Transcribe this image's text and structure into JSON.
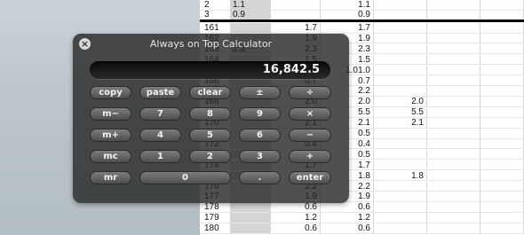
{
  "spreadsheet": {
    "rows": [
      [
        "2",
        "1.1",
        "",
        "1.1",
        "",
        ""
      ],
      [
        "3",
        "0.9",
        "",
        "0.9",
        "",
        ""
      ],
      [
        "161",
        "",
        "1.7",
        "1.7",
        "",
        ""
      ],
      [
        "162",
        "",
        "1.9",
        "1.9",
        "",
        ""
      ],
      [
        "163",
        "2.3",
        "2.3",
        "2.3",
        "",
        ""
      ],
      [
        "164",
        "",
        "1.5",
        "1.5",
        "",
        ""
      ],
      [
        "165",
        "",
        "1.0",
        "1.0",
        "",
        ""
      ],
      [
        "166",
        "",
        "0.7",
        "0.7",
        "",
        ""
      ],
      [
        "167",
        "",
        "2.2",
        "2.2",
        "",
        ""
      ],
      [
        "168",
        "",
        "2.0",
        "2.0",
        "2.0",
        ""
      ],
      [
        "169",
        "",
        "5.5",
        "5.5",
        "5.5",
        ""
      ],
      [
        "170",
        "",
        "2.1",
        "2.1",
        "2.1",
        ""
      ],
      [
        "171",
        "",
        "0.5",
        "0.5",
        "",
        ""
      ],
      [
        "172",
        "",
        "0.4",
        "0.4",
        "",
        ""
      ],
      [
        "173",
        "",
        "0.5",
        "0.5",
        "",
        ""
      ],
      [
        "174",
        "",
        "1.7",
        "1.7",
        "",
        ""
      ],
      [
        "175",
        "",
        "1.8",
        "1.8",
        "1.8",
        ""
      ],
      [
        "176",
        "",
        "2.2",
        "2.2",
        "",
        ""
      ],
      [
        "177",
        "",
        "1.9",
        "1.9",
        "",
        ""
      ],
      [
        "178",
        "",
        "0.6",
        "0.6",
        "",
        ""
      ],
      [
        "179",
        "",
        "1.2",
        "1.2",
        "",
        ""
      ],
      [
        "180",
        "",
        "0.6",
        "0.6",
        "",
        ""
      ]
    ],
    "overflow_value": "1.0"
  },
  "calculator": {
    "title": "Always on Top Calculator",
    "display": "16,842.5",
    "buttons": {
      "copy": "copy",
      "paste": "paste",
      "clear": "clear",
      "plusminus": "±",
      "divide": "÷",
      "mminus": "m−",
      "n7": "7",
      "n8": "8",
      "n9": "9",
      "multiply": "×",
      "mplus": "m+",
      "n4": "4",
      "n5": "5",
      "n6": "6",
      "minus": "−",
      "mc": "mc",
      "n1": "1",
      "n2": "2",
      "n3": "3",
      "plus": "+",
      "mr": "mr",
      "n0": "0",
      "decimal": ".",
      "enter": "enter"
    }
  }
}
